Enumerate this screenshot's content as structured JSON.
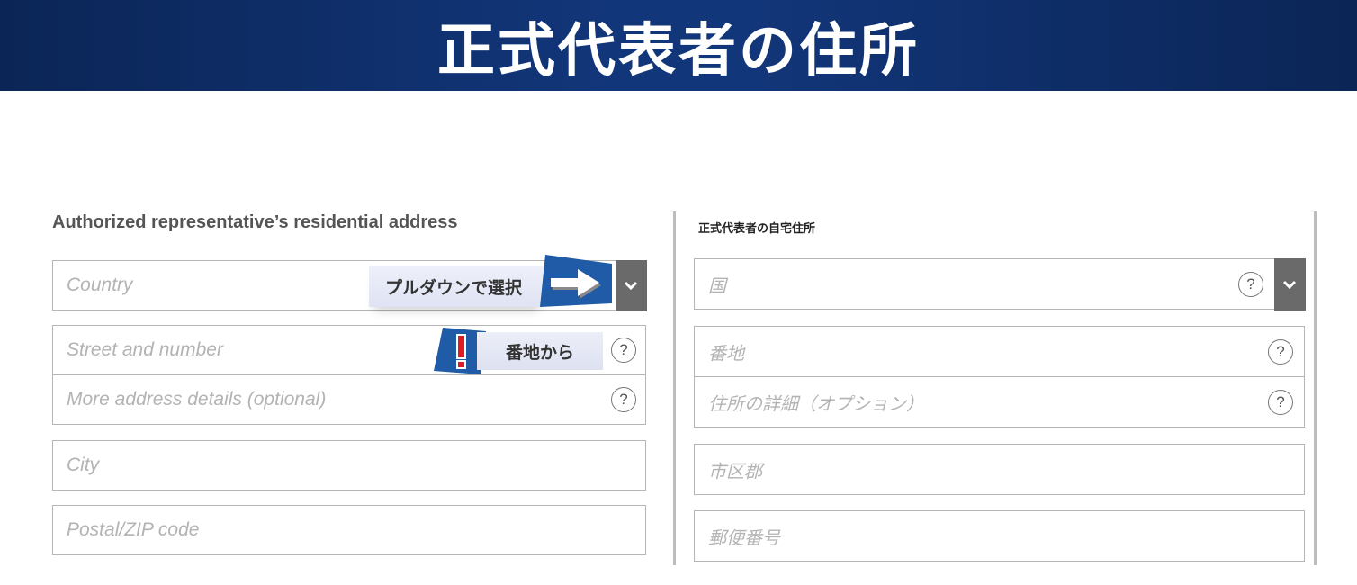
{
  "banner": {
    "title": "正式代表者の住所"
  },
  "left_form": {
    "section_title": "Authorized representative’s residential address",
    "country_placeholder": "Country",
    "street_placeholder": "Street and number",
    "more_placeholder": "More address details (optional)",
    "city_placeholder": "City",
    "zip_placeholder": "Postal/ZIP code",
    "help_symbol": "?"
  },
  "right_form": {
    "section_title": "正式代表者の自宅住所",
    "country_placeholder": "国",
    "street_placeholder": "番地",
    "more_placeholder": "住所の詳細（オプション）",
    "city_placeholder": "市区郡",
    "zip_placeholder": "郵便番号",
    "help_symbol": "?"
  },
  "callouts": {
    "pulldown_label": "プルダウンで選択",
    "street_label": "番地から",
    "alert_symbol": "!"
  },
  "colors": {
    "banner": "#12367a",
    "callout_blue": "#1f5ba6",
    "alert_red": "#e01b24",
    "dropdown_button": "#6a6a6a"
  },
  "icons": {
    "dropdown": "chevron-down-icon",
    "help": "question-circle-icon",
    "arrow": "arrow-right-icon"
  }
}
